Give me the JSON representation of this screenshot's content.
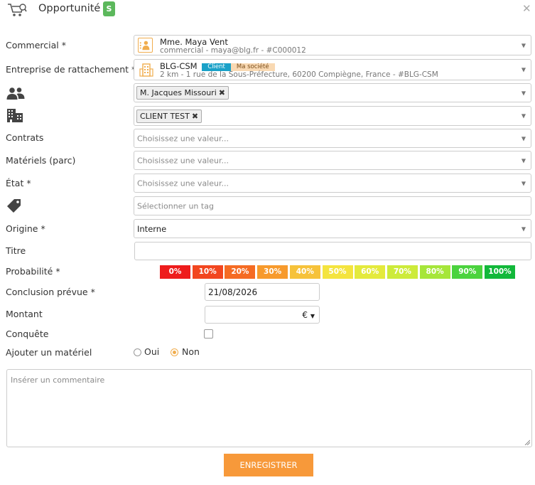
{
  "header": {
    "title": "Opportunité",
    "badge": "S",
    "close": "✕"
  },
  "labels": {
    "commercial": "Commercial *",
    "entreprise": "Entreprise de rattachement *",
    "contrats": "Contrats",
    "materiels": "Matériels (parc)",
    "etat": "État *",
    "origine": "Origine *",
    "titre": "Titre",
    "probabilite": "Probabilité *",
    "conclusion": "Conclusion prévue *",
    "montant": "Montant",
    "conquete": "Conquête",
    "ajouter": "Ajouter un matériel"
  },
  "commercial": {
    "name": "Mme. Maya Vent",
    "sub": "commercial - maya@blg.fr - #C000012"
  },
  "entreprise": {
    "name": "BLG-CSM",
    "tag_client": "Client",
    "tag_societe": "Ma société",
    "sub": "2 km - 1 rue de la Sous-Préfecture, 60200 Compiègne, France - #BLG-CSM"
  },
  "contacts_chip": "M. Jacques Missouri",
  "societes_chip": "CLIENT TEST",
  "chip_remove": "✖",
  "placeholders": {
    "choose": "Choisissez une valeur...",
    "tag": "Sélectionner un tag",
    "comment": "Insérer un commentaire"
  },
  "origine_value": "Interne",
  "probabilities": [
    {
      "label": "0%",
      "color": "#ee1c1c"
    },
    {
      "label": "10%",
      "color": "#f2461f"
    },
    {
      "label": "20%",
      "color": "#f56b23"
    },
    {
      "label": "30%",
      "color": "#f79a2c"
    },
    {
      "label": "40%",
      "color": "#f6c23a"
    },
    {
      "label": "50%",
      "color": "#f4e43e"
    },
    {
      "label": "60%",
      "color": "#e4ea3c"
    },
    {
      "label": "70%",
      "color": "#cdeb3a"
    },
    {
      "label": "80%",
      "color": "#a6e63a"
    },
    {
      "label": "90%",
      "color": "#4bd33e"
    },
    {
      "label": "100%",
      "color": "#12b83a"
    }
  ],
  "conclusion_date": "21/08/2026",
  "currency": "€",
  "radio": {
    "oui": "Oui",
    "non": "Non",
    "selected": "non"
  },
  "save_label": "ENREGISTRER"
}
